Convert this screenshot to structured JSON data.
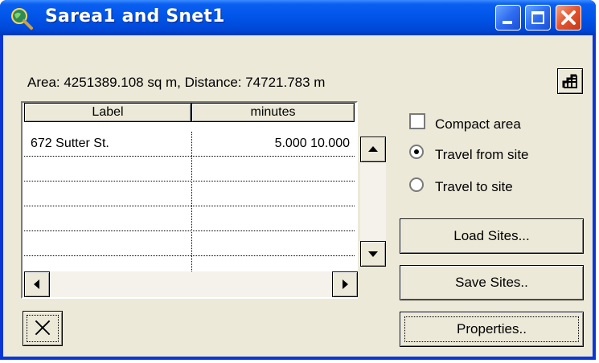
{
  "window": {
    "title": "Sarea1 and Snet1"
  },
  "info": {
    "text": "Area: 4251389.108 sq m, Distance: 74721.783 m"
  },
  "table": {
    "columns": [
      "Label",
      "minutes"
    ],
    "rows": [
      {
        "label": "672 Sutter St.",
        "minutes": "5.000 10.000"
      },
      {
        "label": "",
        "minutes": ""
      },
      {
        "label": "",
        "minutes": ""
      },
      {
        "label": "",
        "minutes": ""
      },
      {
        "label": "",
        "minutes": ""
      }
    ]
  },
  "options": {
    "compact_area": {
      "label": "Compact area",
      "checked": false
    },
    "travel_from_site": {
      "label": "Travel from site",
      "selected": true
    },
    "travel_to_site": {
      "label": "Travel to site",
      "selected": false
    }
  },
  "buttons": {
    "load_sites": "Load Sites...",
    "save_sites": "Save Sites..",
    "properties": "Properties.."
  },
  "icons": {
    "app": "globe-magnifier-icon",
    "corner": "grid-stairs-icon",
    "clear": "x-icon"
  }
}
